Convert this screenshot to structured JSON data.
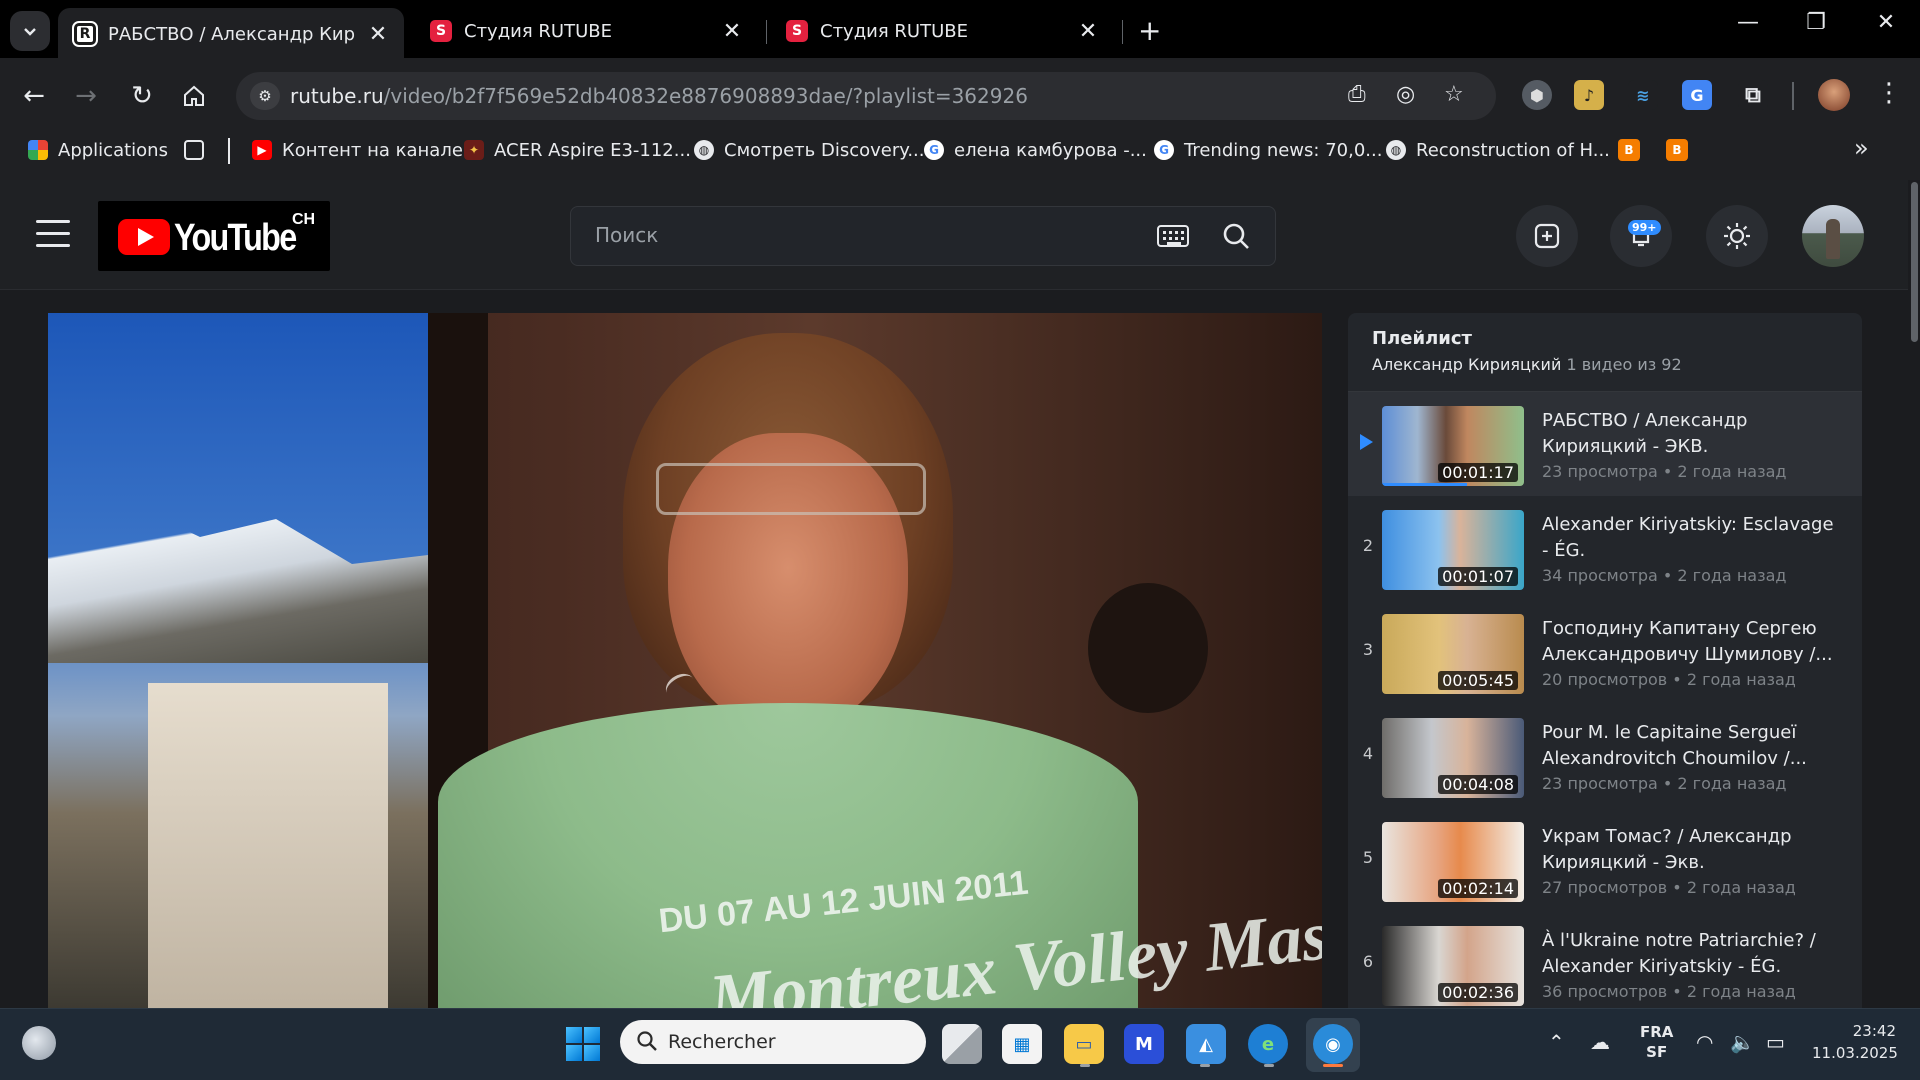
{
  "browser": {
    "tabs": [
      {
        "title": "РАБСТВО / Александр Кириящ",
        "favicon": "rutube-r-icon",
        "active": true
      },
      {
        "title": "Студия RUTUBE",
        "favicon": "rutube-studio-icon",
        "active": false
      },
      {
        "title": "Студия RUTUBE",
        "favicon": "rutube-studio-icon",
        "active": false
      }
    ],
    "omnibox": {
      "host": "rutube.ru",
      "path": "/video/b2f7f569e52db40832e8876908893dae/?playlist=362926"
    },
    "bookmarks": [
      {
        "label": "Applications",
        "icon": "apps-grid-icon"
      },
      {
        "label": "",
        "icon": "tab-groups-icon"
      },
      {
        "label": "Контент на канале",
        "icon": "youtube-icon",
        "color": "#ff0000"
      },
      {
        "label": "ACER Aspire E3-112...",
        "icon": "acer-icon"
      },
      {
        "label": "Смотреть Discovery...",
        "icon": "globe-icon"
      },
      {
        "label": "елена камбурова -...",
        "icon": "google-icon"
      },
      {
        "label": "Trending news: 70,0...",
        "icon": "google-icon"
      },
      {
        "label": "Reconstruction of H...",
        "icon": "globe-icon"
      },
      {
        "label": "",
        "icon": "blogger-icon"
      },
      {
        "label": "",
        "icon": "blogger-icon"
      }
    ]
  },
  "site": {
    "logo_text": "YouTube",
    "logo_sup": "CH",
    "search": {
      "placeholder": "Поиск"
    },
    "notifications_badge": "99+"
  },
  "playlist": {
    "title": "Плейлист",
    "author": "Александр Кирияцкий",
    "count": "1 видео из 92",
    "items": [
      {
        "index": "",
        "title": "РАБСТВО / Александр Кирияцкий - ЭКВ.",
        "duration": "00:01:17",
        "views": "23 просмотра",
        "age": "2 года назад",
        "current": true
      },
      {
        "index": "2",
        "title": "Alexander Kiriyatskiy: Esclavage - ÉG.",
        "duration": "00:01:07",
        "views": "34 просмотра",
        "age": "2 года назад",
        "current": false
      },
      {
        "index": "3",
        "title": "Господину Капитану Сергею Александровичу Шумилову /...",
        "duration": "00:05:45",
        "views": "20 просмотров",
        "age": "2 года назад",
        "current": false
      },
      {
        "index": "4",
        "title": "Pour M. le Capitaine Sergueï Alexandrovitch Choumilov /...",
        "duration": "00:04:08",
        "views": "23 просмотра",
        "age": "2 года назад",
        "current": false
      },
      {
        "index": "5",
        "title": "Украм Томас? / Александр Кирияцкий - Экв.",
        "duration": "00:02:14",
        "views": "27 просмотров",
        "age": "2 года назад",
        "current": false
      },
      {
        "index": "6",
        "title": "À l'Ukraine notre Patriarchie? / Alexander Kiriyatskiy - ÉG.",
        "duration": "00:02:36",
        "views": "36 просмотров",
        "age": "2 года назад",
        "current": false
      }
    ]
  },
  "video": {
    "shirt_line1": "DU 07 AU 12 JUIN 2011",
    "shirt_line2": "Montreux Volley Masters"
  },
  "taskbar": {
    "search_placeholder": "Rechercher",
    "lang": "FRA",
    "layout": "SF",
    "time": "23:42",
    "date": "11.03.2025"
  }
}
